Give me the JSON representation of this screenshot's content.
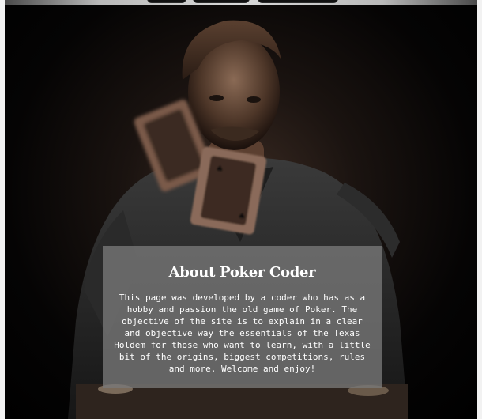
{
  "about": {
    "title": "About Poker Coder",
    "text": "This page was developed by a coder who has as a\nhobby and passion the old game of Poker. The\nobjective of the site is to explain in a clear\nand objective way the essentials of the Texas\nHoldem for those who want to learn, with a little\nbit of the origins, biggest competitions, rules\nand more. Welcome and enjoy!"
  },
  "hero": {
    "image_subject": "man-throwing-playing-cards"
  }
}
